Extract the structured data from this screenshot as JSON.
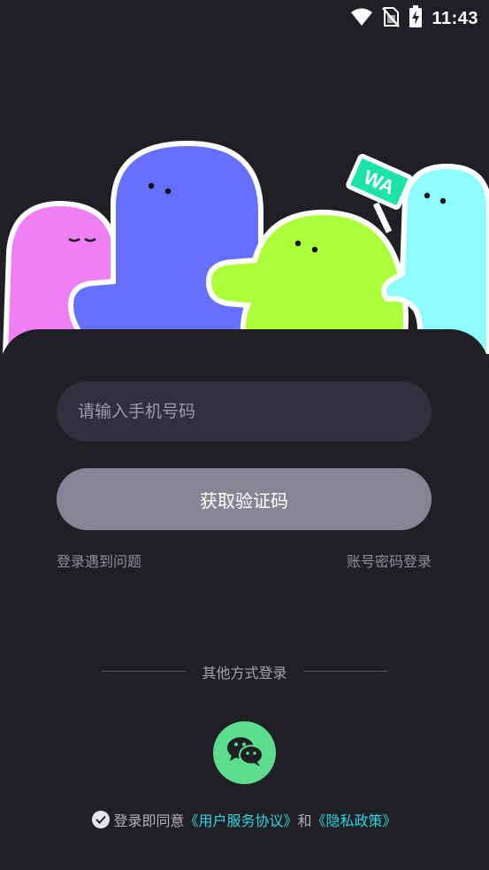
{
  "status_bar": {
    "time": "11:43",
    "icons": [
      "wifi-icon",
      "no-sim-icon",
      "battery-charging-icon"
    ]
  },
  "hero": {
    "sign_text": "WA",
    "colors": {
      "pink": "#f07ff5",
      "blue": "#6670ff",
      "green": "#adff3a",
      "cyan": "#8ffcff",
      "sign": "#1de3a8"
    }
  },
  "login": {
    "phone_placeholder": "请输入手机号码",
    "get_code_label": "获取验证码",
    "trouble_link": "登录遇到问题",
    "password_login_link": "账号密码登录"
  },
  "other_login": {
    "divider_text": "其他方式登录",
    "wechat_icon": "wechat-icon",
    "wechat_color": "#5bdd8b"
  },
  "agreement": {
    "prefix": "登录即同意",
    "user_agreement": "《用户服务协议》",
    "and": "和",
    "privacy_policy": "《隐私政策》",
    "accent_color": "#2fd6dd"
  }
}
